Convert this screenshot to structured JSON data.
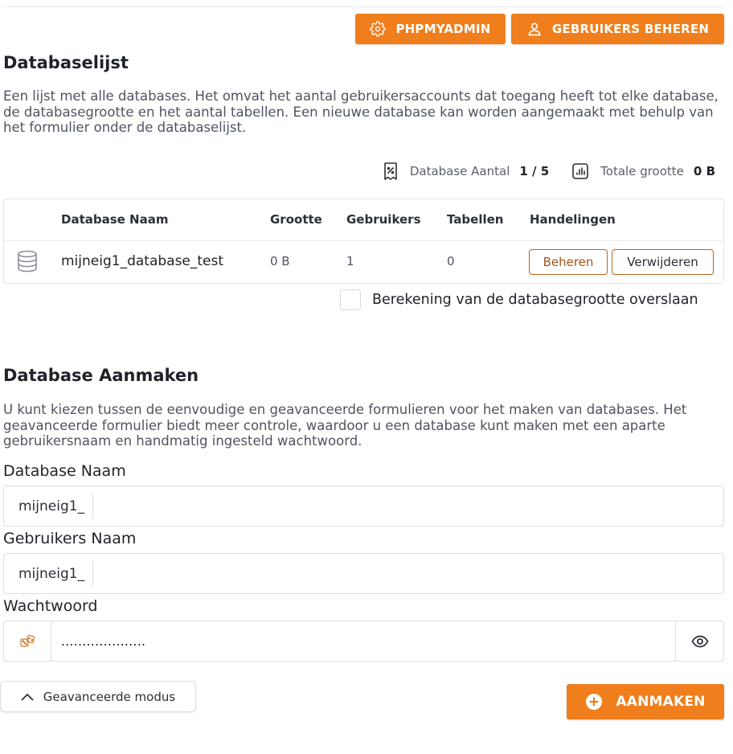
{
  "toolbar": {
    "phpmyadmin_label": "PHPMYADMIN",
    "manage_users_label": "GEBRUIKERS BEHEREN"
  },
  "database_list": {
    "title": "Databaselijst",
    "description": "Een lijst met alle databases. Het omvat het aantal gebruikersaccounts dat toegang heeft tot elke database, de databasegrootte en het aantal tabellen. Een nieuwe database kan worden aangemaakt met behulp van het formulier onder de databaselijst.",
    "stats": {
      "count_label": "Database Aantal",
      "count_value": "1 / 5",
      "size_label": "Totale grootte",
      "size_value": "0 B"
    },
    "columns": {
      "name": "Database Naam",
      "size": "Grootte",
      "users": "Gebruikers",
      "tables": "Tabellen",
      "actions": "Handelingen"
    },
    "rows": [
      {
        "name": "mijneig1_database_test",
        "size": "0 B",
        "users": "1",
        "tables": "0",
        "manage_label": "Beheren",
        "delete_label": "Verwijderen"
      }
    ],
    "skip_size_label": "Berekening van de databasegrootte overslaan"
  },
  "create_database": {
    "title": "Database Aanmaken",
    "description": "U kunt kiezen tussen de eenvoudige en geavanceerde formulieren voor het maken van databases. Het geavanceerde formulier biedt meer controle, waardoor u een database kunt maken met een aparte gebruikersnaam en handmatig ingesteld wachtwoord.",
    "db_name_label": "Database Naam",
    "db_name_prefix": "mijneig1_",
    "db_name_value": "",
    "user_name_label": "Gebruikers Naam",
    "user_name_prefix": "mijneig1_",
    "user_name_value": "",
    "password_label": "Wachtwoord",
    "password_value": "....................",
    "advanced_mode_label": "Geavanceerde modus",
    "create_label": "AANMAKEN"
  },
  "colors": {
    "accent": "#f07e1c",
    "outline": "#b8641c"
  },
  "icons": [
    "settings-icon",
    "user-icon",
    "receipt-icon",
    "bar-chart-icon",
    "database-icon",
    "dice-icon",
    "eye-icon",
    "chevron-up-icon",
    "plus-circle-icon"
  ]
}
